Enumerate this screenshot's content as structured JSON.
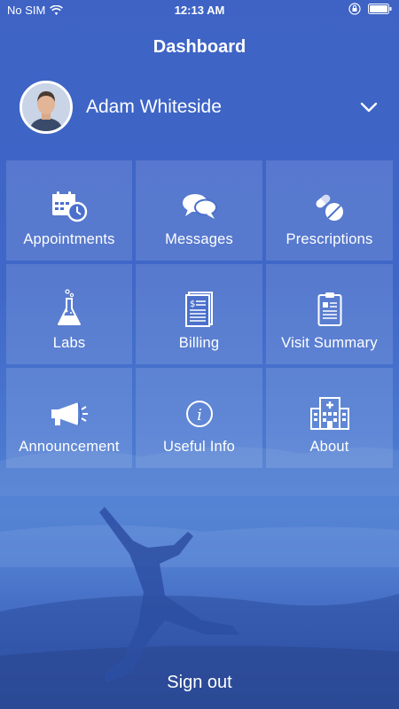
{
  "status_bar": {
    "carrier": "No SIM",
    "time": "12:13 AM"
  },
  "header": {
    "title": "Dashboard"
  },
  "profile": {
    "name": "Adam Whiteside"
  },
  "tiles": [
    {
      "label": "Appointments",
      "icon": "calendar-clock-icon"
    },
    {
      "label": "Messages",
      "icon": "chat-bubbles-icon"
    },
    {
      "label": "Prescriptions",
      "icon": "pills-icon"
    },
    {
      "label": "Labs",
      "icon": "flask-icon"
    },
    {
      "label": "Billing",
      "icon": "invoice-icon"
    },
    {
      "label": "Visit Summary",
      "icon": "clipboard-icon"
    },
    {
      "label": "Announcement",
      "icon": "megaphone-icon"
    },
    {
      "label": "Useful Info",
      "icon": "info-icon"
    },
    {
      "label": "About",
      "icon": "hospital-icon"
    }
  ],
  "footer": {
    "signout_label": "Sign out"
  },
  "colors": {
    "background": "#3e63c5",
    "text": "#ffffff",
    "tile": "rgba(255,255,255,0.13)"
  }
}
